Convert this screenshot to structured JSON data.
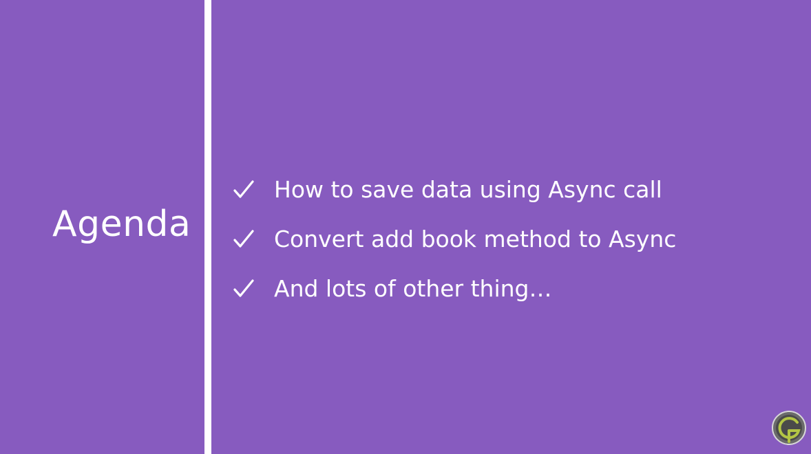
{
  "slide": {
    "title": "Agenda",
    "items": [
      {
        "label": "How to save data using Async call"
      },
      {
        "label": "Convert add book method to Async"
      },
      {
        "label": "And lots of other thing…"
      }
    ]
  },
  "icons": {
    "bullet": "check-icon",
    "corner_logo": "g-logo-icon"
  },
  "colors": {
    "background": "#875bbf",
    "text": "#ffffff",
    "divider": "#ffffff",
    "logo_accent": "#b3c544"
  }
}
